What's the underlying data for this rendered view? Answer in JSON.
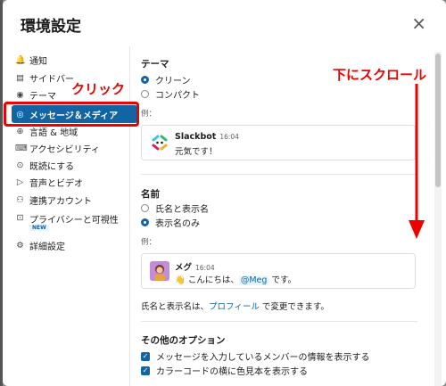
{
  "dialog": {
    "title": "環境設定",
    "close_glyph": "×"
  },
  "sidebar": {
    "items": [
      {
        "label": "通知",
        "icon": "bell-icon",
        "glyph": "🔔"
      },
      {
        "label": "サイドバー",
        "icon": "sidebar-icon",
        "glyph": "▤"
      },
      {
        "label": "テーマ",
        "icon": "eye-icon",
        "glyph": "◉"
      },
      {
        "label": "メッセージ＆メディア",
        "icon": "message-icon",
        "glyph": "◎",
        "active": true
      },
      {
        "label": "言語 & 地域",
        "icon": "globe-icon",
        "glyph": "⊕"
      },
      {
        "label": "アクセシビリティ",
        "icon": "keyboard-icon",
        "glyph": "⌨"
      },
      {
        "label": "既読にする",
        "icon": "check-circle-icon",
        "glyph": "⊙"
      },
      {
        "label": "音声とビデオ",
        "icon": "video-icon",
        "glyph": "▷"
      },
      {
        "label": "連携アカウント",
        "icon": "link-icon",
        "glyph": "⚇"
      },
      {
        "label": "プライバシーと可視性",
        "icon": "lock-icon",
        "glyph": "⊡",
        "badge": "NEW"
      },
      {
        "label": "詳細設定",
        "icon": "gear-icon",
        "glyph": "⚙"
      }
    ]
  },
  "annotations": {
    "click": "クリック",
    "scroll": "下にスクロール"
  },
  "theme": {
    "title": "テーマ",
    "options": [
      {
        "label": "クリーン",
        "selected": true
      },
      {
        "label": "コンパクト",
        "selected": false
      }
    ],
    "example_label": "例：",
    "preview": {
      "name": "Slackbot",
      "time": "16:04",
      "message": "元気です！"
    }
  },
  "names": {
    "title": "名前",
    "options": [
      {
        "label": "氏名と表示名",
        "selected": false
      },
      {
        "label": "表示名のみ",
        "selected": true
      }
    ],
    "example_label": "例：",
    "preview": {
      "name": "メグ",
      "time": "16:04",
      "message_prefix": "👋 こんにちは、",
      "mention": "@Meg",
      "message_suffix": " です。"
    },
    "note_prefix": "氏名と表示名は、",
    "note_link": "プロフィール",
    "note_suffix": " で変更できます。"
  },
  "other": {
    "title": "その他のオプション",
    "options": [
      {
        "label": "メッセージを入力しているメンバーの情報を表示する",
        "checked": true
      },
      {
        "label": "カラーコードの横に色見本を表示する",
        "checked": true
      }
    ]
  },
  "colors": {
    "accent": "#1264a3",
    "annotation_red": "#e00000"
  }
}
